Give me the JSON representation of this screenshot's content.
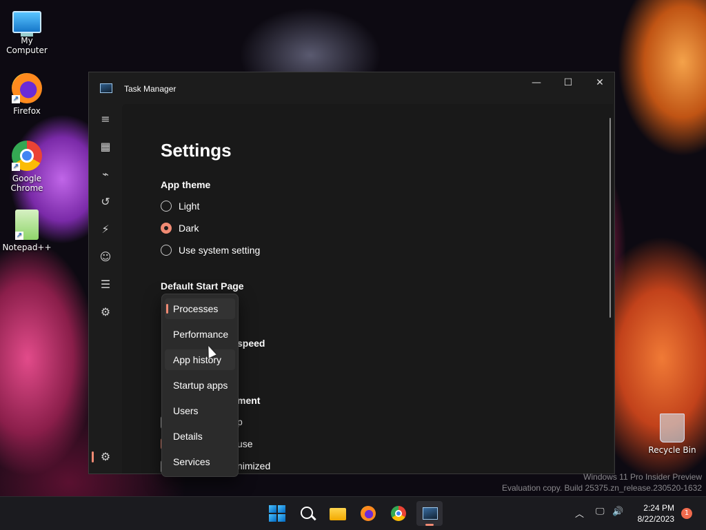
{
  "desktop": {
    "icons": [
      {
        "label": "My Computer",
        "icon": "monitor-icon"
      },
      {
        "label": "Firefox",
        "icon": "firefox-icon"
      },
      {
        "label": "Google Chrome",
        "icon": "chrome-icon"
      },
      {
        "label": "Notepad++",
        "icon": "notepadpp-icon"
      },
      {
        "label": "Recycle Bin",
        "icon": "recycle-bin-icon"
      }
    ],
    "watermark": {
      "line1": "Windows 11 Pro Insider Preview",
      "line2": "Evaluation copy. Build 25375.zn_release.230520-1632"
    }
  },
  "window": {
    "title": "Task Manager",
    "controls": {
      "minimize": "—",
      "maximize": "☐",
      "close": "✕"
    },
    "nav": [
      {
        "name": "hamburger-icon",
        "glyph": "≡"
      },
      {
        "name": "processes-icon",
        "glyph": "▦"
      },
      {
        "name": "performance-icon",
        "glyph": "⌁"
      },
      {
        "name": "app-history-icon",
        "glyph": "↺"
      },
      {
        "name": "startup-apps-icon",
        "glyph": "⚡"
      },
      {
        "name": "users-icon",
        "glyph": "☺"
      },
      {
        "name": "details-icon",
        "glyph": "☰"
      },
      {
        "name": "services-icon",
        "glyph": "⚙"
      },
      {
        "name": "settings-icon",
        "glyph": "⚙"
      }
    ]
  },
  "settings": {
    "heading": "Settings",
    "app_theme": {
      "label": "App theme",
      "options": [
        "Light",
        "Dark",
        "Use system setting"
      ],
      "selected": "Dark"
    },
    "default_start_page": {
      "label": "Default Start Page",
      "options": [
        "Processes",
        "Performance",
        "App history",
        "Startup apps",
        "Users",
        "Details",
        "Services"
      ],
      "selected": "Processes"
    },
    "partial_labels": {
      "speed": "speed",
      "ment": "ment",
      "p": "p",
      "use": "use",
      "nimized": "nimized"
    }
  },
  "taskbar": {
    "clock_time": "2:24 PM",
    "clock_date": "8/22/2023",
    "notification_count": "1",
    "accent": "#f08a73"
  }
}
